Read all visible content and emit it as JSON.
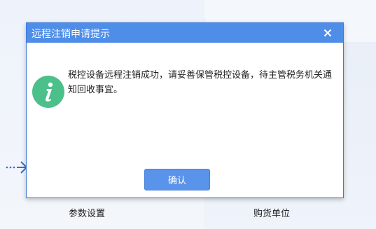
{
  "background": {
    "left_label": "参数设置",
    "right_label": "购货单位"
  },
  "dialog": {
    "title": "远程注销申请提示",
    "close_icon": "close-icon",
    "info_icon": "info-icon",
    "message": "税控设备远程注销成功，请妥善保管税控设备，待主管税务机关通知回收事宜。",
    "confirm_label": "确认"
  },
  "colors": {
    "titlebar": "#4f8ee8",
    "button": "#5a93ea",
    "info_icon": "#4cc08a",
    "arrow": "#3a6fc9"
  }
}
